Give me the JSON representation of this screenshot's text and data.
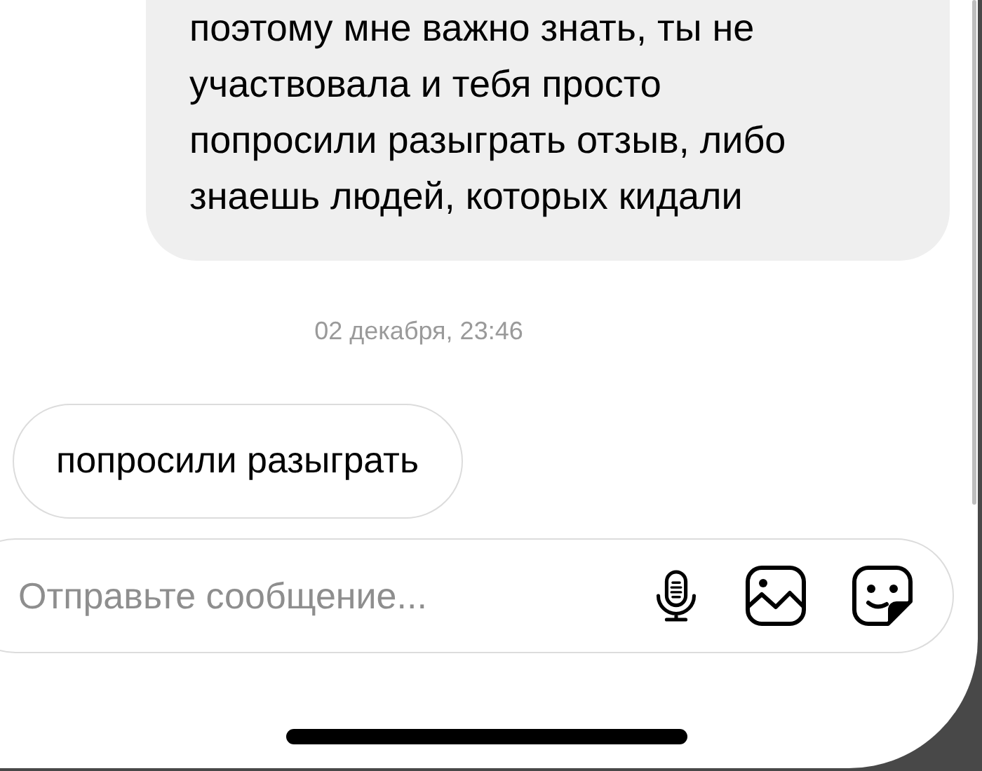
{
  "messages": [
    {
      "kind": "sent",
      "text": "поэтому мне важно знать, ты не\nучаствовала и тебя просто\nпопросили разыграть отзыв, либо\nзнаешь людей, которых кидали"
    },
    {
      "kind": "timestamp",
      "text": "02 декабря, 23:46"
    },
    {
      "kind": "received",
      "text": "попросили разыграть"
    }
  ],
  "composer": {
    "placeholder": "Отправьте сообщение..."
  }
}
